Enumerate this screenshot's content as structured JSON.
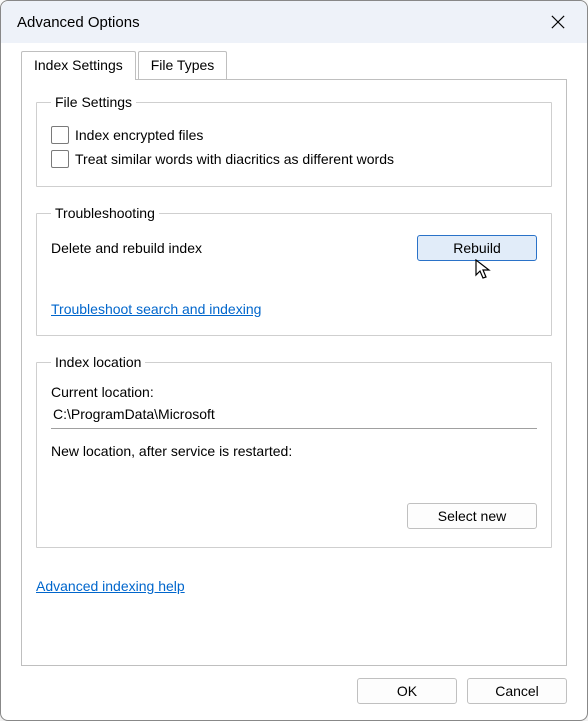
{
  "window": {
    "title": "Advanced Options"
  },
  "tabs": {
    "index_settings": "Index Settings",
    "file_types": "File Types"
  },
  "file_settings": {
    "legend": "File Settings",
    "index_encrypted": "Index encrypted files",
    "diacritics": "Treat similar words with diacritics as different words"
  },
  "troubleshooting": {
    "legend": "Troubleshooting",
    "delete_rebuild": "Delete and rebuild index",
    "rebuild_btn": "Rebuild",
    "troubleshoot_link": "Troubleshoot search and indexing"
  },
  "index_location": {
    "legend": "Index location",
    "current_label": "Current location:",
    "current_value": "C:\\ProgramData\\Microsoft",
    "new_label": "New location, after service is restarted:",
    "new_value": "",
    "select_new_btn": "Select new"
  },
  "help_link": "Advanced indexing help",
  "buttons": {
    "ok": "OK",
    "cancel": "Cancel"
  }
}
